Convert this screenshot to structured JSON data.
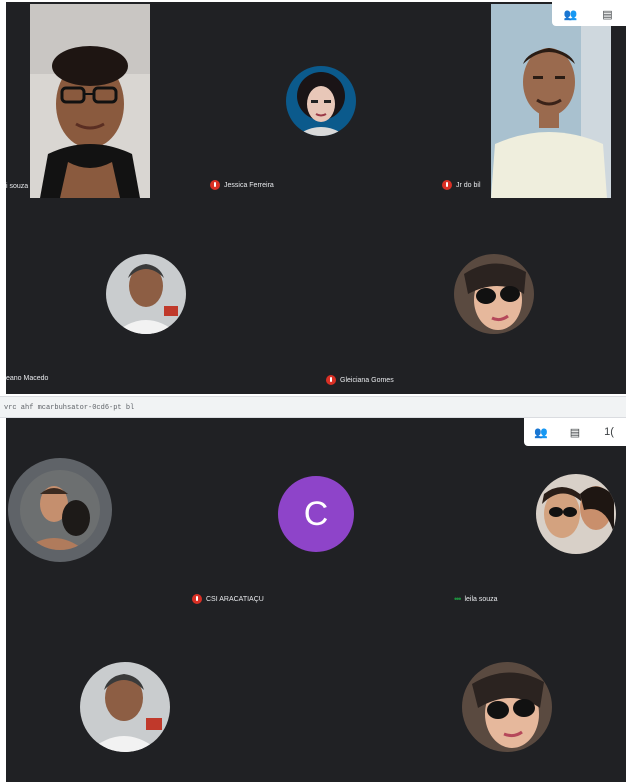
{
  "top": {
    "participants": [
      {
        "name": "i souza"
      },
      {
        "name": "Jessica Ferreira"
      },
      {
        "name": "Jr do bil"
      },
      {
        "name": "eano Macedo"
      },
      {
        "name": "Gleiciana Gomes"
      }
    ],
    "toolbar_icons": [
      "people-icon",
      "chat-icon"
    ]
  },
  "address_bar": {
    "text": "vrc ahf mcarbuhsator-0cd6-pt bl"
  },
  "bottom": {
    "participants": [
      {
        "name": ""
      },
      {
        "name": "CSI ARACATIAÇU",
        "initial": "C"
      },
      {
        "name": "leila souza"
      },
      {
        "name": ""
      },
      {
        "name": ""
      }
    ],
    "toolbar_icons": [
      "people-icon",
      "chat-icon"
    ],
    "toolbar_extra": "1("
  },
  "colors": {
    "meet_background": "#202124",
    "avatar_purple": "#8e44c9",
    "mic_off_red": "#d93025",
    "speaking_green": "#1e8e3e"
  }
}
